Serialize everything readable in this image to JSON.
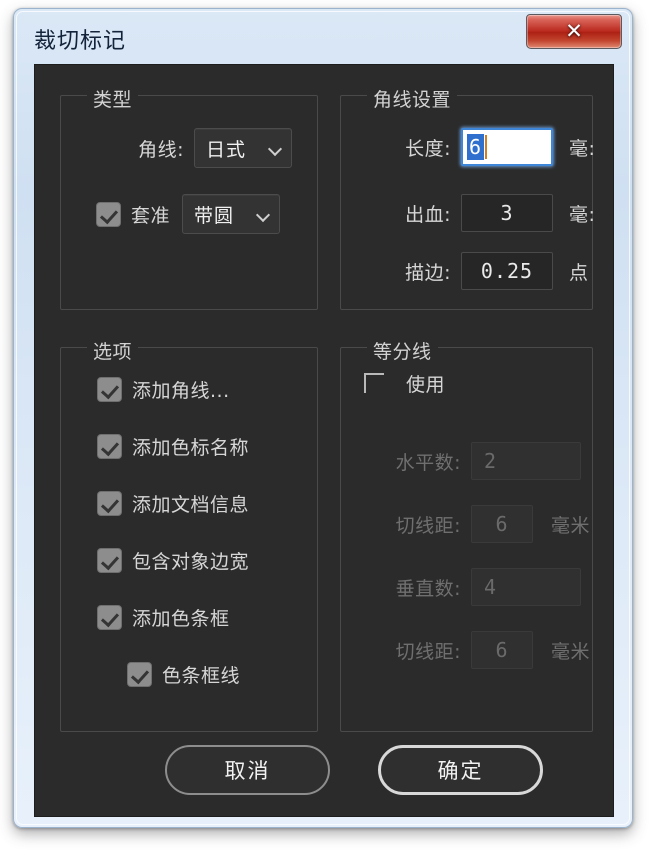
{
  "window": {
    "title": "裁切标记",
    "close_label": "✕",
    "frame_color": "#cfe0f2",
    "content_bg": "#2b2b2b",
    "accent_focus": "#3d86d8",
    "close_color": "#b9281d"
  },
  "groups": {
    "type": {
      "title": "类型",
      "corner_mark": {
        "label": "角线:",
        "value": "日式"
      },
      "registration": {
        "checkbox_label": "套准",
        "checked": true,
        "value": "带圆"
      }
    },
    "mark_settings": {
      "title": "角线设置",
      "rows": [
        {
          "label": "长度:",
          "value": "6",
          "unit": "毫:",
          "focused": true
        },
        {
          "label": "出血:",
          "value": "3",
          "unit": "毫:",
          "focused": false
        },
        {
          "label": "描边:",
          "value": "0.25",
          "unit": "点",
          "focused": false
        }
      ]
    },
    "options": {
      "title": "选项",
      "items": [
        {
          "label": "添加角线...",
          "checked": true,
          "indent": false
        },
        {
          "label": "添加色标名称",
          "checked": true,
          "indent": false
        },
        {
          "label": "添加文档信息",
          "checked": true,
          "indent": false
        },
        {
          "label": "包含对象边宽",
          "checked": true,
          "indent": false
        },
        {
          "label": "添加色条框",
          "checked": true,
          "indent": false
        },
        {
          "label": "色条框线",
          "checked": true,
          "indent": true
        }
      ]
    },
    "divide_lines": {
      "title": "等分线",
      "enable": {
        "label": "使用",
        "checked": false
      },
      "disabled": true,
      "rows": [
        {
          "label": "水平数:",
          "value": "2",
          "unit": ""
        },
        {
          "label": "切线距:",
          "value": "6",
          "unit": "毫米"
        },
        {
          "label": "垂直数:",
          "value": "4",
          "unit": ""
        },
        {
          "label": "切线距:",
          "value": "6",
          "unit": "毫米"
        }
      ]
    }
  },
  "footer": {
    "cancel": "取消",
    "ok": "确定"
  }
}
